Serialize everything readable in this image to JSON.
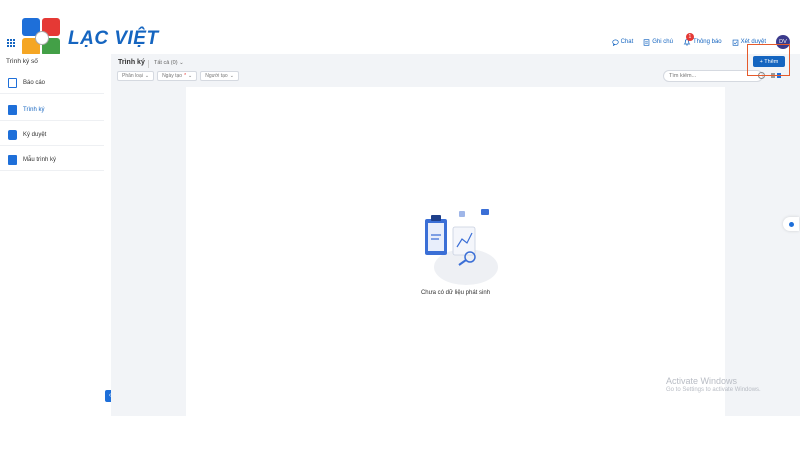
{
  "brand": {
    "name": "LẠC VIỆT",
    "colors": [
      "#1e6fd9",
      "#e53935",
      "#f5a623",
      "#43a047"
    ]
  },
  "header": {
    "actions": [
      {
        "label": "Chat",
        "icon": "chat-icon"
      },
      {
        "label": "Ghi chú",
        "icon": "note-icon"
      },
      {
        "label": "Thông báo",
        "icon": "bell-icon",
        "badge": "1"
      },
      {
        "label": "Xét duyệt",
        "icon": "approval-icon"
      }
    ],
    "avatar_initials": "DV"
  },
  "sidebar": {
    "title": "Trình ký số",
    "items": [
      {
        "label": "Báo cáo",
        "icon": "report-icon",
        "active": false
      },
      {
        "label": "Trình ký",
        "icon": "document-icon",
        "active": true
      },
      {
        "label": "Ký duyệt",
        "icon": "sign-icon",
        "active": false
      },
      {
        "label": "Mẫu trình ký",
        "icon": "template-icon",
        "active": false
      }
    ]
  },
  "main": {
    "title": "Trình ký",
    "view_select": "Tất cả (0)",
    "filters": [
      {
        "label": "Phân loại",
        "required": false
      },
      {
        "label": "Ngày tạo",
        "required": true
      },
      {
        "label": "Người tạo",
        "required": false
      }
    ],
    "search_placeholder": "Tìm kiếm...",
    "add_button": "+ Thêm",
    "empty_message": "Chưa có dữ liệu phát sinh"
  },
  "watermark": {
    "title": "Activate Windows",
    "subtitle": "Go to Settings to activate Windows."
  },
  "accent_color": "#1565c0",
  "highlight_color": "#e55a2b"
}
